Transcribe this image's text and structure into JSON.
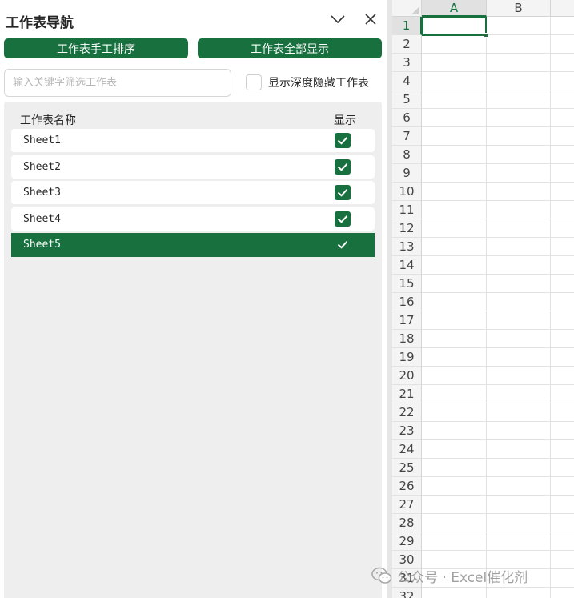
{
  "navigator": {
    "title": "工作表导航",
    "collapse_icon": "chevron-down-icon",
    "close_icon": "close-icon",
    "buttons": {
      "manual_sort": "工作表手工排序",
      "show_all": "工作表全部显示"
    },
    "filter": {
      "placeholder": "输入关键字筛选工作表",
      "value": ""
    },
    "deep_hidden": {
      "label": "显示深度隐藏工作表",
      "checked": false
    },
    "list": {
      "col_name": "工作表名称",
      "col_show": "显示",
      "rows": [
        {
          "name": "Sheet1",
          "visible": true,
          "selected": false
        },
        {
          "name": "Sheet2",
          "visible": true,
          "selected": false
        },
        {
          "name": "Sheet3",
          "visible": true,
          "selected": false
        },
        {
          "name": "Sheet4",
          "visible": true,
          "selected": false
        },
        {
          "name": "Sheet5",
          "visible": true,
          "selected": true
        }
      ]
    }
  },
  "spreadsheet": {
    "columns": [
      "A",
      "B"
    ],
    "active_column": "A",
    "active_row": "1",
    "rows": [
      "1",
      "2",
      "3",
      "4",
      "5",
      "6",
      "7",
      "8",
      "9",
      "10",
      "11",
      "12",
      "13",
      "14",
      "15",
      "16",
      "17",
      "18",
      "19",
      "20",
      "21",
      "22",
      "23",
      "24",
      "25",
      "26",
      "27",
      "28",
      "29",
      "30",
      "31",
      "32"
    ]
  },
  "watermark": {
    "text": "公众号 · Excel催化剂",
    "icon": "wechat-icon"
  },
  "colors": {
    "accent": "#17703e",
    "panel_bg": "#eeeeee",
    "header_bg": "#f4f4f4"
  }
}
